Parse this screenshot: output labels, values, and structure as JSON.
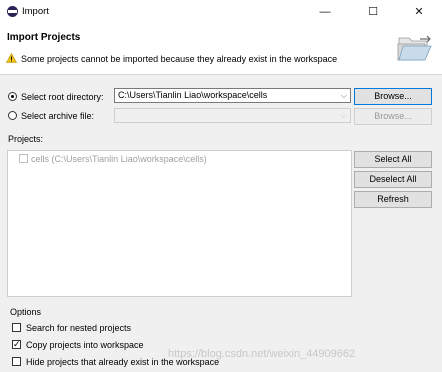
{
  "window": {
    "title": "Import",
    "minimize_glyph": "—",
    "maximize_glyph": "☐",
    "close_glyph": "✕"
  },
  "header": {
    "title": "Import Projects",
    "warning_text": "Some projects cannot be imported because they already exist in the workspace",
    "warning_icon": "warning-icon",
    "banner_icon": "folder-icon"
  },
  "source": {
    "root_directory_label": "Select root directory:",
    "root_directory_value": "C:\\Users\\Tianlin Liao\\workspace\\cells",
    "root_selected": true,
    "archive_label": "Select archive file:",
    "archive_value": "",
    "browse_label": "Browse...",
    "browse_disabled_label": "Browse..."
  },
  "projects": {
    "label": "Projects:",
    "items": [
      {
        "label": "cells (C:\\Users\\Tianlin Liao\\workspace\\cells)",
        "checked": false,
        "disabled": true
      }
    ],
    "select_all_label": "Select All",
    "deselect_all_label": "Deselect All",
    "refresh_label": "Refresh"
  },
  "options": {
    "label": "Options",
    "nested_label": "Search for nested projects",
    "nested_checked": false,
    "copy_label": "Copy projects into workspace",
    "copy_checked": true,
    "hide_label": "Hide projects that already exist in the workspace",
    "hide_checked": false
  },
  "watermark": "https://blog.csdn.net/weixin_44909662",
  "colors": {
    "focus": "#0078d7",
    "warning": "#f0c419"
  }
}
